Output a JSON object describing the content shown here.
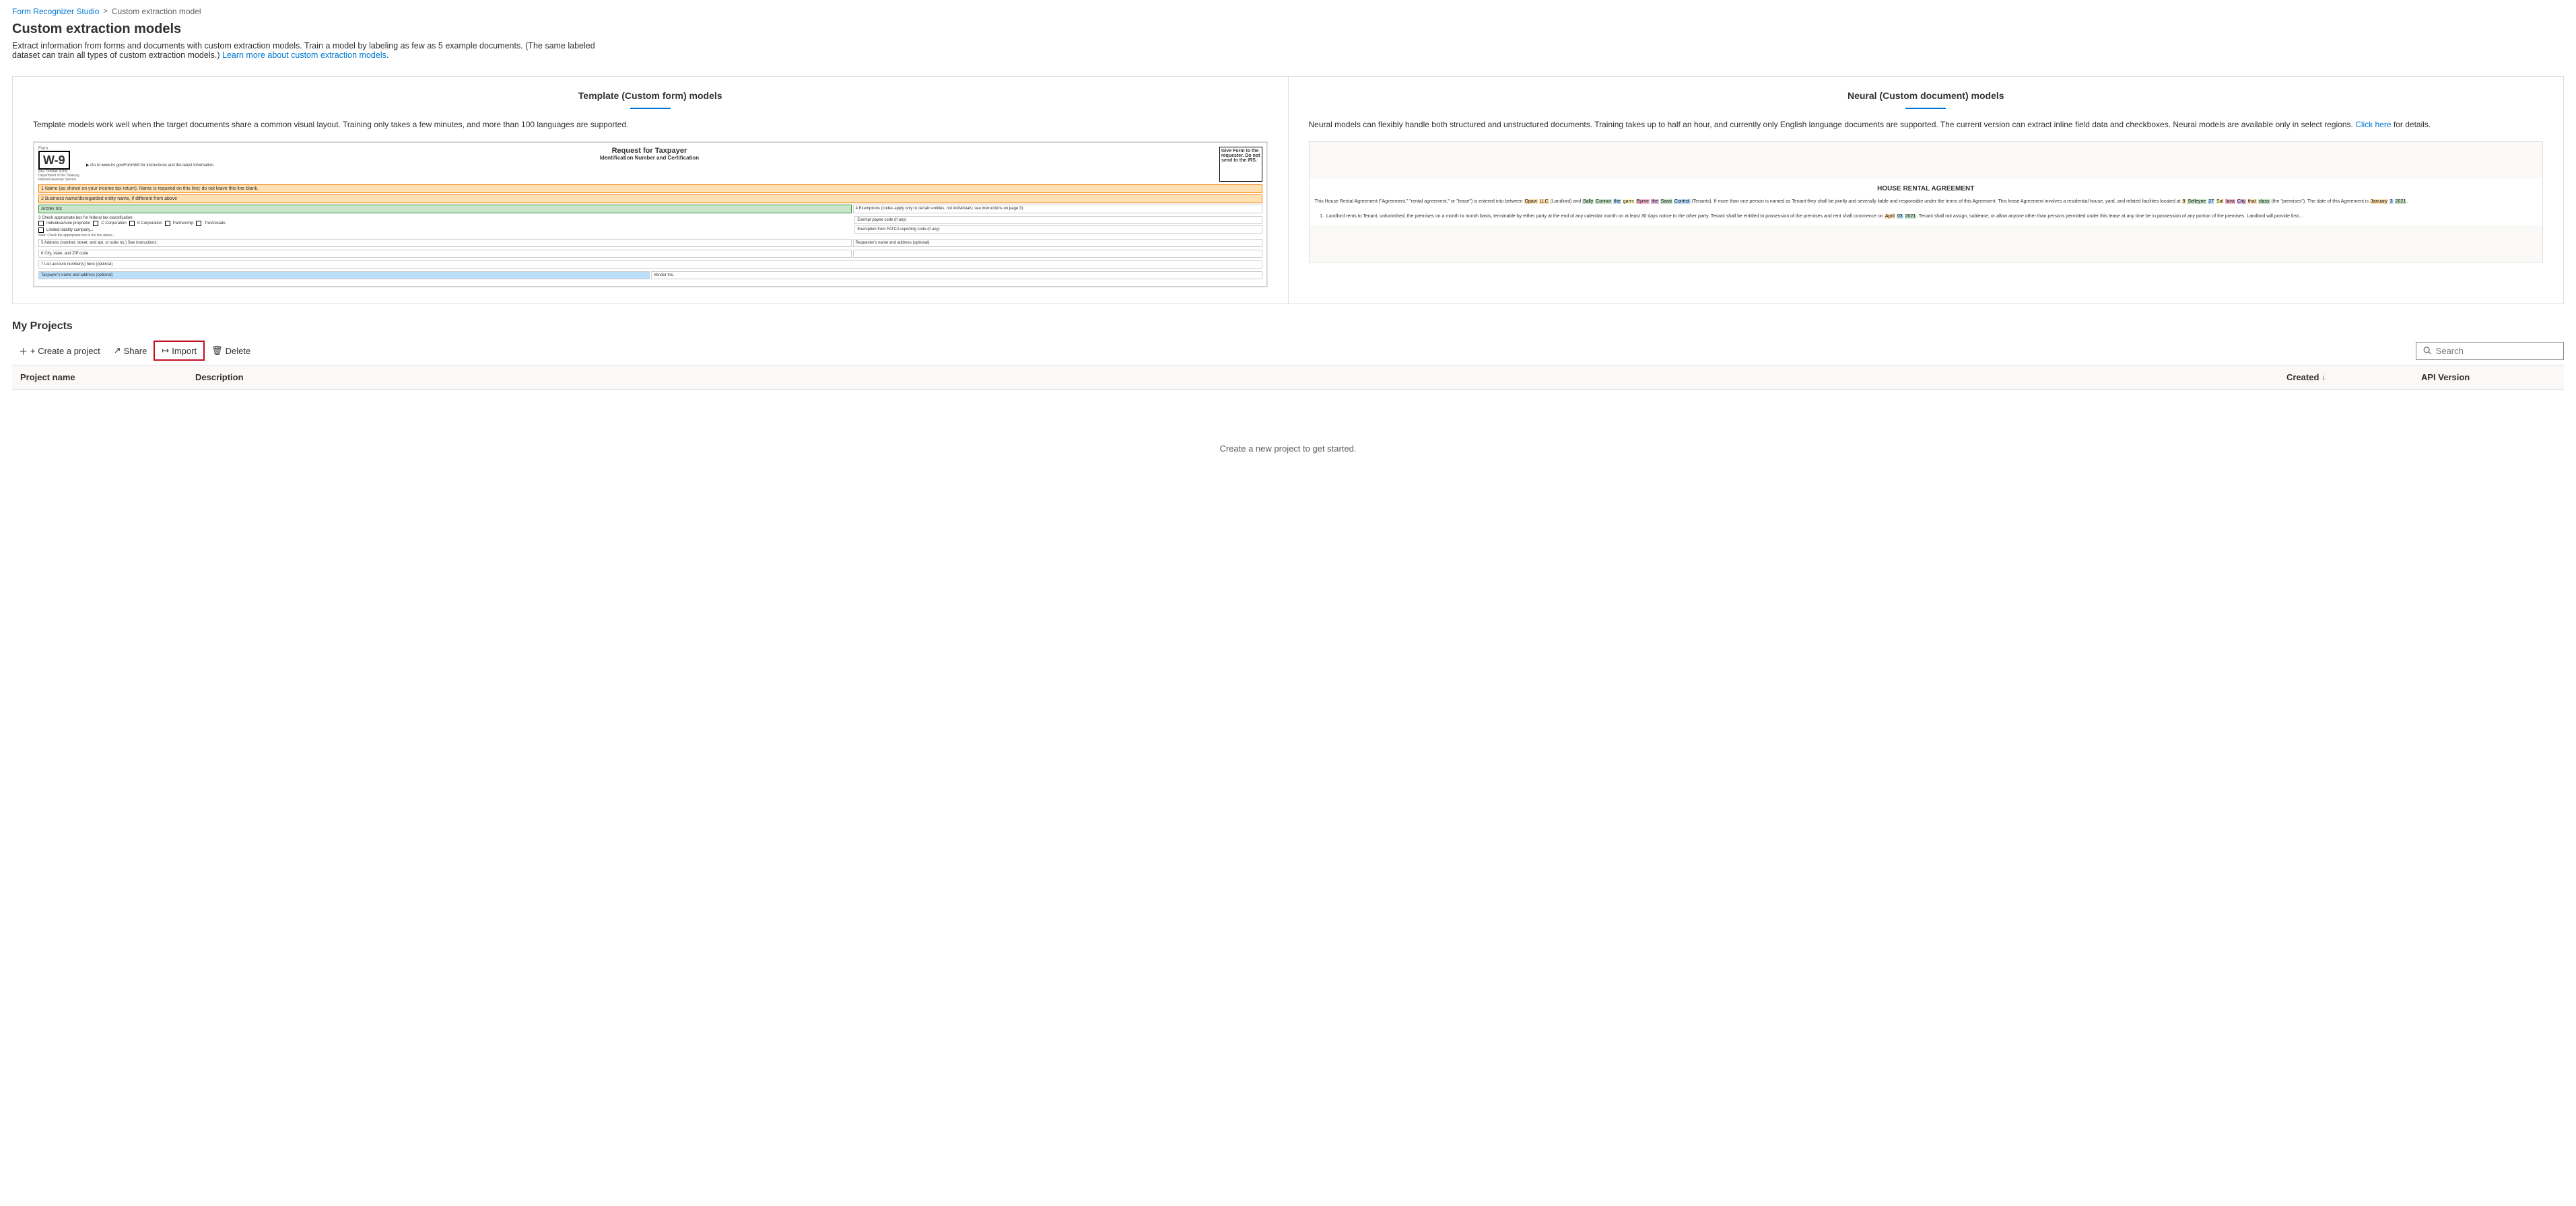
{
  "breadcrumb": {
    "home": "Form Recognizer Studio",
    "separator": ">",
    "current": "Custom extraction model"
  },
  "page": {
    "title": "Custom extraction models",
    "description": "Extract information from forms and documents with custom extraction models. Train a model by labeling as few as 5 example documents. (The same labeled dataset can train all types of custom extraction models.)",
    "learn_more_text": "Learn more about custom extraction models.",
    "learn_more_url": "#"
  },
  "template_panel": {
    "title": "Template (Custom form) models",
    "description": "Template models work well when the target documents share a common visual layout. Training only takes a few minutes, and more than 100 languages are supported."
  },
  "neural_panel": {
    "title": "Neural (Custom document) models",
    "description": "Neural models can flexibly handle both structured and unstructured documents. Training takes up to half an hour, and currently only English language documents are supported. The current version can extract inline field data and checkboxes. Neural models are available only in select regions.",
    "click_here_text": "Click here",
    "for_details": "for details."
  },
  "projects": {
    "section_title": "My Projects",
    "toolbar": {
      "create": "+ Create a project",
      "share": "Share",
      "import": "Import",
      "delete": "Delete"
    },
    "table": {
      "columns": {
        "project_name": "Project name",
        "description": "Description",
        "created": "Created",
        "api_version": "API Version"
      }
    },
    "empty_state": "Create a new project to get started.",
    "search_placeholder": "Search"
  }
}
